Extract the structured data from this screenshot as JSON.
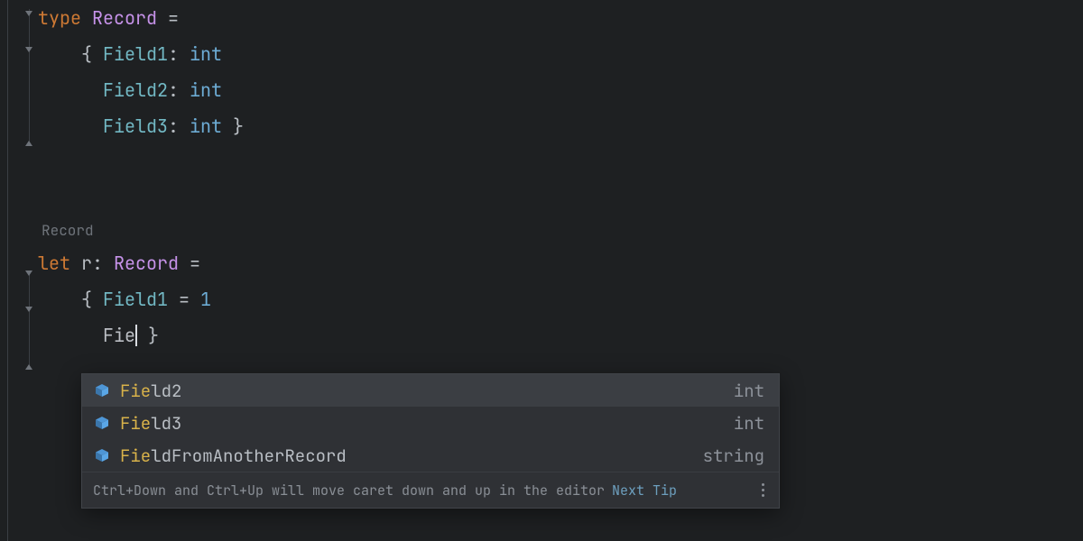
{
  "lines": {
    "l1": {
      "kw": "type",
      "name": "Record",
      "eq": " ="
    },
    "l2": {
      "open": "{ ",
      "field": "Field1",
      "colon": ": ",
      "type": "int"
    },
    "l3": {
      "field": "Field2",
      "colon": ": ",
      "type": "int"
    },
    "l4": {
      "field": "Field3",
      "colon": ": ",
      "type": "int",
      "close": " }"
    },
    "hint": "Record",
    "l6": {
      "kw": "let",
      "name": " r",
      "colon": ": ",
      "type": "Record",
      "eq": " ="
    },
    "l7": {
      "open": "{ ",
      "field": "Field1",
      "eq": " = ",
      "val": "1"
    },
    "l8": {
      "typed": "Fie",
      "close": " }"
    }
  },
  "completion": {
    "items": [
      {
        "match": "Fie",
        "rest": "ld2",
        "type": "int",
        "selected": true
      },
      {
        "match": "Fie",
        "rest": "ld3",
        "type": "int",
        "selected": false
      },
      {
        "match": "Fie",
        "rest": "ldFromAnotherRecord",
        "type": "string",
        "selected": false
      }
    ],
    "footer_text": "Ctrl+Down and Ctrl+Up will move caret down and up in the editor",
    "footer_link": "Next Tip"
  }
}
